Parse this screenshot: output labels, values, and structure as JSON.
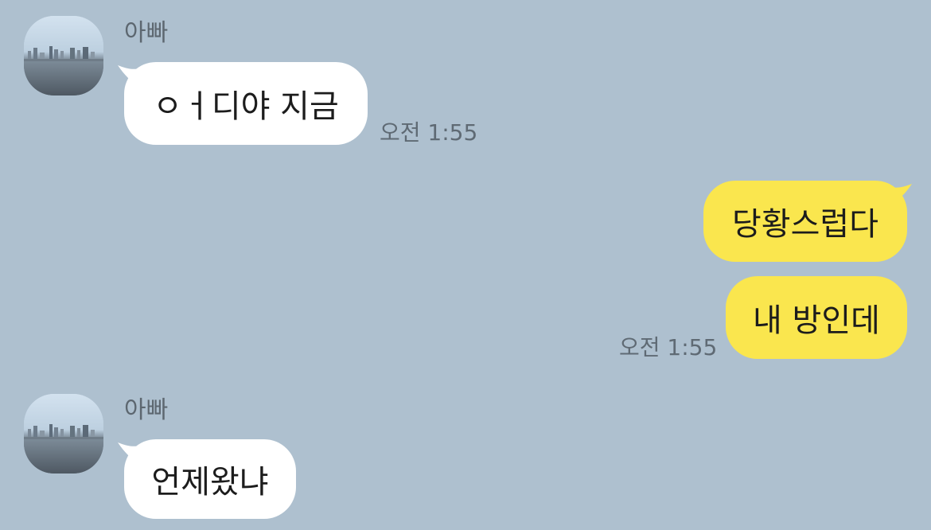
{
  "colors": {
    "background": "#aec0cf",
    "incoming_bubble": "#ffffff",
    "outgoing_bubble": "#fae64e"
  },
  "messages": [
    {
      "sender": "아빠",
      "text": "ㅇㅓ디야 지금",
      "time": "오전 1:55"
    },
    {
      "text": "당황스럽다"
    },
    {
      "text": "내 방인데",
      "time": "오전 1:55"
    },
    {
      "sender": "아빠",
      "text": "언제왔냐"
    }
  ]
}
